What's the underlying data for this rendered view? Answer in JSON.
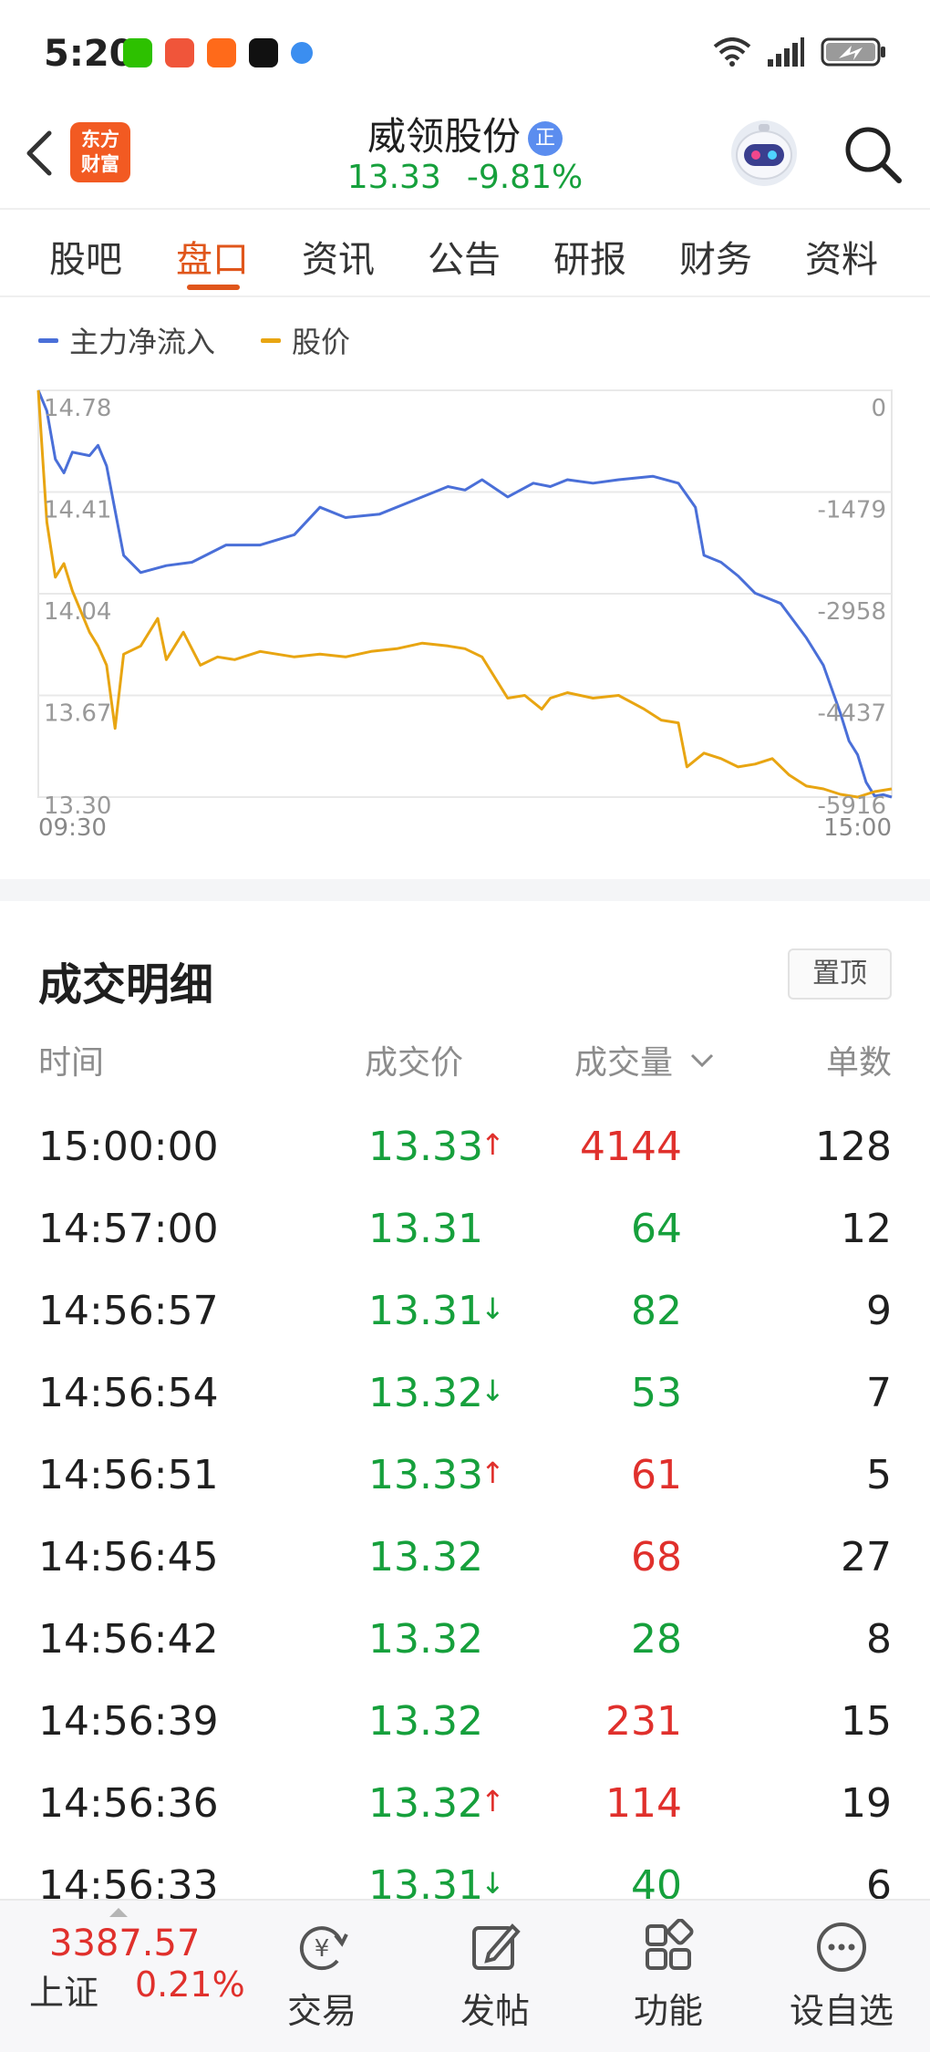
{
  "status_bar": {
    "time": "5:20",
    "app_icons": [
      "wechat-icon",
      "game-app-icon",
      "send-app-icon",
      "tiktok-icon",
      "browser-icon"
    ],
    "right_icons": [
      "wifi-icon",
      "signal-icon",
      "battery-charging-icon"
    ]
  },
  "header": {
    "brand_logo_text": "东方\n财富",
    "stock_name": "威领股份",
    "stock_badge": "正",
    "price": "13.33",
    "change_pct": "-9.81%"
  },
  "tabs": [
    {
      "label": "股吧",
      "active": false
    },
    {
      "label": "盘口",
      "active": true
    },
    {
      "label": "资讯",
      "active": false
    },
    {
      "label": "公告",
      "active": false
    },
    {
      "label": "研报",
      "active": false
    },
    {
      "label": "财务",
      "active": false
    },
    {
      "label": "资料",
      "active": false
    }
  ],
  "chart_data": {
    "type": "line",
    "legend": [
      {
        "name": "主力净流入",
        "color": "#4a6fd8"
      },
      {
        "name": "股价",
        "color": "#e8a512"
      }
    ],
    "left_ticks": [
      "14.78",
      "14.41",
      "14.04",
      "13.67",
      "13.30"
    ],
    "right_ticks": [
      "0",
      "-1479",
      "-2958",
      "-4437",
      "-5916"
    ],
    "x_ticks": [
      "09:30",
      "15:00"
    ],
    "left_ylim": [
      13.3,
      14.78
    ],
    "right_ylim": [
      -5916,
      0
    ],
    "grid": true,
    "series": [
      {
        "name": "主力净流入",
        "axis": "right",
        "x_progress": [
          0,
          0.01,
          0.02,
          0.03,
          0.04,
          0.06,
          0.07,
          0.08,
          0.1,
          0.12,
          0.15,
          0.18,
          0.22,
          0.26,
          0.3,
          0.33,
          0.36,
          0.4,
          0.44,
          0.48,
          0.5,
          0.52,
          0.55,
          0.58,
          0.6,
          0.62,
          0.65,
          0.68,
          0.72,
          0.75,
          0.77,
          0.78,
          0.8,
          0.82,
          0.84,
          0.87,
          0.9,
          0.92,
          0.94,
          0.95,
          0.96,
          0.97,
          0.98,
          0.99,
          1.0
        ],
        "values": [
          0,
          -300,
          -1000,
          -1200,
          -900,
          -950,
          -800,
          -1100,
          -2400,
          -2650,
          -2550,
          -2500,
          -2250,
          -2250,
          -2100,
          -1700,
          -1850,
          -1800,
          -1600,
          -1400,
          -1450,
          -1300,
          -1550,
          -1350,
          -1400,
          -1300,
          -1350,
          -1300,
          -1250,
          -1350,
          -1700,
          -2400,
          -2500,
          -2700,
          -2950,
          -3100,
          -3600,
          -4000,
          -4700,
          -5100,
          -5300,
          -5700,
          -5900,
          -5880,
          -5916
        ]
      },
      {
        "name": "股价",
        "axis": "left",
        "x_progress": [
          0,
          0.01,
          0.02,
          0.03,
          0.04,
          0.06,
          0.07,
          0.08,
          0.09,
          0.1,
          0.12,
          0.14,
          0.15,
          0.17,
          0.19,
          0.21,
          0.23,
          0.26,
          0.3,
          0.33,
          0.36,
          0.39,
          0.42,
          0.45,
          0.48,
          0.5,
          0.52,
          0.55,
          0.57,
          0.59,
          0.6,
          0.62,
          0.65,
          0.68,
          0.71,
          0.73,
          0.75,
          0.76,
          0.78,
          0.8,
          0.82,
          0.84,
          0.86,
          0.88,
          0.9,
          0.92,
          0.94,
          0.96,
          0.98,
          1.0
        ],
        "values": [
          14.78,
          14.3,
          14.1,
          14.15,
          14.05,
          13.9,
          13.85,
          13.78,
          13.55,
          13.82,
          13.85,
          13.95,
          13.8,
          13.9,
          13.78,
          13.81,
          13.8,
          13.83,
          13.81,
          13.82,
          13.81,
          13.83,
          13.84,
          13.86,
          13.85,
          13.84,
          13.81,
          13.66,
          13.67,
          13.62,
          13.66,
          13.68,
          13.66,
          13.67,
          13.62,
          13.58,
          13.57,
          13.41,
          13.46,
          13.44,
          13.41,
          13.42,
          13.44,
          13.38,
          13.34,
          13.33,
          13.31,
          13.3,
          13.32,
          13.33
        ]
      }
    ]
  },
  "details": {
    "title": "成交明细",
    "pin_label": "置顶",
    "columns": {
      "time": "时间",
      "price": "成交价",
      "volume": "成交量",
      "count": "单数"
    },
    "sort_icon": "chevron-down-icon",
    "rows": [
      {
        "time": "15:00:00",
        "price": "13.33",
        "arrow": "↑",
        "arrow_color": "#e0302c",
        "volume": "4144",
        "vol_color": "#e0302c",
        "count": "128"
      },
      {
        "time": "14:57:00",
        "price": "13.31",
        "arrow": "",
        "arrow_color": "#16a03c",
        "volume": "64",
        "vol_color": "#16a03c",
        "count": "12"
      },
      {
        "time": "14:56:57",
        "price": "13.31",
        "arrow": "↓",
        "arrow_color": "#16a03c",
        "volume": "82",
        "vol_color": "#16a03c",
        "count": "9"
      },
      {
        "time": "14:56:54",
        "price": "13.32",
        "arrow": "↓",
        "arrow_color": "#16a03c",
        "volume": "53",
        "vol_color": "#16a03c",
        "count": "7"
      },
      {
        "time": "14:56:51",
        "price": "13.33",
        "arrow": "↑",
        "arrow_color": "#e0302c",
        "volume": "61",
        "vol_color": "#e0302c",
        "count": "5"
      },
      {
        "time": "14:56:45",
        "price": "13.32",
        "arrow": "",
        "arrow_color": "#16a03c",
        "volume": "68",
        "vol_color": "#e0302c",
        "count": "27"
      },
      {
        "time": "14:56:42",
        "price": "13.32",
        "arrow": "",
        "arrow_color": "#16a03c",
        "volume": "28",
        "vol_color": "#16a03c",
        "count": "8"
      },
      {
        "time": "14:56:39",
        "price": "13.32",
        "arrow": "",
        "arrow_color": "#16a03c",
        "volume": "231",
        "vol_color": "#e0302c",
        "count": "15"
      },
      {
        "time": "14:56:36",
        "price": "13.32",
        "arrow": "↑",
        "arrow_color": "#e0302c",
        "volume": "114",
        "vol_color": "#e0302c",
        "count": "19"
      },
      {
        "time": "14:56:33",
        "price": "13.31",
        "arrow": "↓",
        "arrow_color": "#16a03c",
        "volume": "40",
        "vol_color": "#16a03c",
        "count": "6"
      }
    ]
  },
  "bottom_bar": {
    "index_value": "3387.57",
    "index_name": "上证",
    "index_change": "0.21%",
    "nav": [
      {
        "label": "交易",
        "icon": "yuan-refresh-icon"
      },
      {
        "label": "发帖",
        "icon": "edit-icon"
      },
      {
        "label": "功能",
        "icon": "grid-icon"
      },
      {
        "label": "设自选",
        "icon": "more-dots-icon"
      }
    ]
  }
}
